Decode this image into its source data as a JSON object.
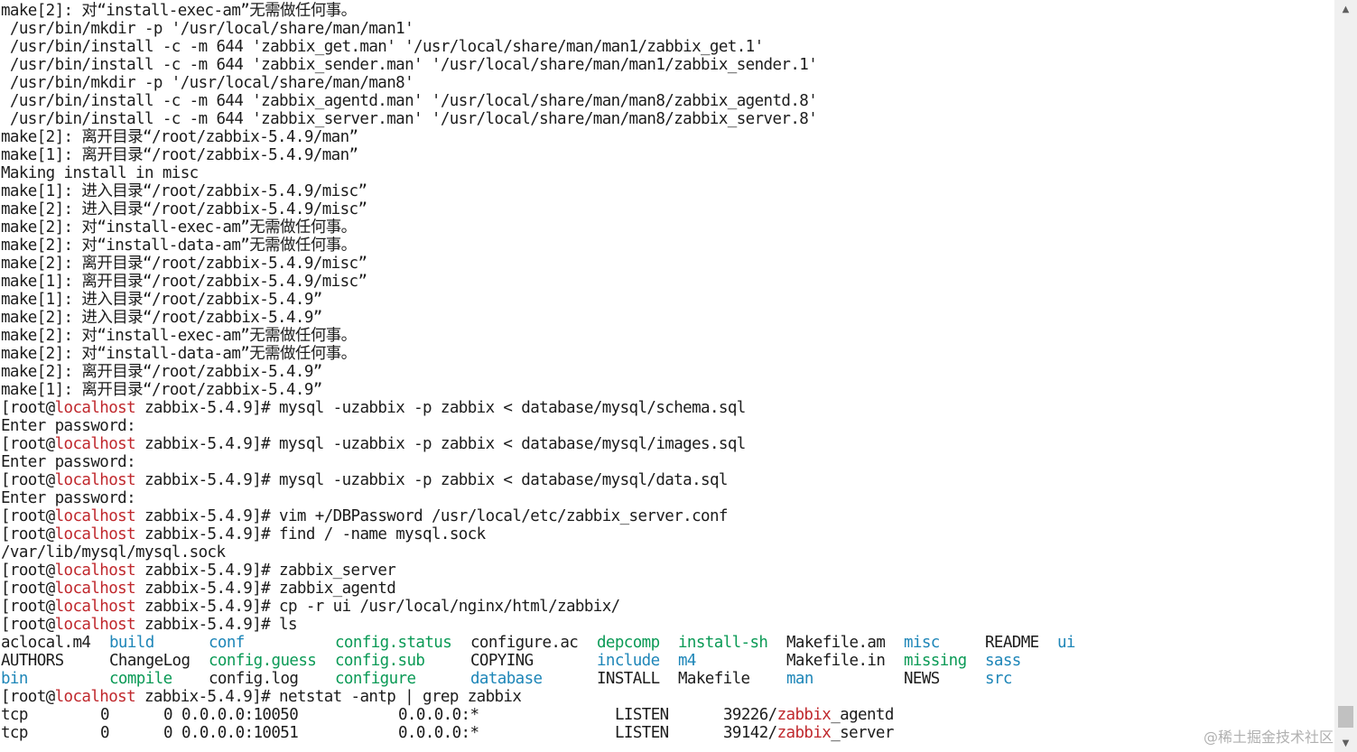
{
  "colors": {
    "background": "#ffffff",
    "text": "#1c1c1c",
    "hostname": "#c0282d",
    "directory": "#1e86b8",
    "executable": "#0b9a56"
  },
  "terminal": {
    "lines": [
      [
        {
          "t": "make[2]: 对“install-exec-am”无需做任何事。"
        }
      ],
      [
        {
          "t": " /usr/bin/mkdir -p '/usr/local/share/man/man1'"
        }
      ],
      [
        {
          "t": " /usr/bin/install -c -m 644 'zabbix_get.man' '/usr/local/share/man/man1/zabbix_get.1'"
        }
      ],
      [
        {
          "t": " /usr/bin/install -c -m 644 'zabbix_sender.man' '/usr/local/share/man/man1/zabbix_sender.1'"
        }
      ],
      [
        {
          "t": " /usr/bin/mkdir -p '/usr/local/share/man/man8'"
        }
      ],
      [
        {
          "t": " /usr/bin/install -c -m 644 'zabbix_agentd.man' '/usr/local/share/man/man8/zabbix_agentd.8'"
        }
      ],
      [
        {
          "t": " /usr/bin/install -c -m 644 'zabbix_server.man' '/usr/local/share/man/man8/zabbix_server.8'"
        }
      ],
      [
        {
          "t": "make[2]: 离开目录“/root/zabbix-5.4.9/man”"
        }
      ],
      [
        {
          "t": "make[1]: 离开目录“/root/zabbix-5.4.9/man”"
        }
      ],
      [
        {
          "t": "Making install in misc"
        }
      ],
      [
        {
          "t": "make[1]: 进入目录“/root/zabbix-5.4.9/misc”"
        }
      ],
      [
        {
          "t": "make[2]: 进入目录“/root/zabbix-5.4.9/misc”"
        }
      ],
      [
        {
          "t": "make[2]: 对“install-exec-am”无需做任何事。"
        }
      ],
      [
        {
          "t": "make[2]: 对“install-data-am”无需做任何事。"
        }
      ],
      [
        {
          "t": "make[2]: 离开目录“/root/zabbix-5.4.9/misc”"
        }
      ],
      [
        {
          "t": "make[1]: 离开目录“/root/zabbix-5.4.9/misc”"
        }
      ],
      [
        {
          "t": "make[1]: 进入目录“/root/zabbix-5.4.9”"
        }
      ],
      [
        {
          "t": "make[2]: 进入目录“/root/zabbix-5.4.9”"
        }
      ],
      [
        {
          "t": "make[2]: 对“install-exec-am”无需做任何事。"
        }
      ],
      [
        {
          "t": "make[2]: 对“install-data-am”无需做任何事。"
        }
      ],
      [
        {
          "t": "make[2]: 离开目录“/root/zabbix-5.4.9”"
        }
      ],
      [
        {
          "t": "make[1]: 离开目录“/root/zabbix-5.4.9”"
        }
      ],
      [
        {
          "t": "[root@"
        },
        {
          "t": "localhost",
          "c": "red"
        },
        {
          "t": " zabbix-5.4.9]# mysql -uzabbix -p zabbix < database/mysql/schema.sql"
        }
      ],
      [
        {
          "t": "Enter password:"
        }
      ],
      [
        {
          "t": "[root@"
        },
        {
          "t": "localhost",
          "c": "red"
        },
        {
          "t": " zabbix-5.4.9]# mysql -uzabbix -p zabbix < database/mysql/images.sql"
        }
      ],
      [
        {
          "t": "Enter password:"
        }
      ],
      [
        {
          "t": "[root@"
        },
        {
          "t": "localhost",
          "c": "red"
        },
        {
          "t": " zabbix-5.4.9]# mysql -uzabbix -p zabbix < database/mysql/data.sql"
        }
      ],
      [
        {
          "t": "Enter password:"
        }
      ],
      [
        {
          "t": "[root@"
        },
        {
          "t": "localhost",
          "c": "red"
        },
        {
          "t": " zabbix-5.4.9]# vim +/DBPassword /usr/local/etc/zabbix_server.conf"
        }
      ],
      [
        {
          "t": "[root@"
        },
        {
          "t": "localhost",
          "c": "red"
        },
        {
          "t": " zabbix-5.4.9]# find / -name mysql.sock"
        }
      ],
      [
        {
          "t": "/var/lib/mysql/mysql.sock"
        }
      ],
      [
        {
          "t": "[root@"
        },
        {
          "t": "localhost",
          "c": "red"
        },
        {
          "t": " zabbix-5.4.9]# zabbix_server"
        }
      ],
      [
        {
          "t": "[root@"
        },
        {
          "t": "localhost",
          "c": "red"
        },
        {
          "t": " zabbix-5.4.9]# zabbix_agentd"
        }
      ],
      [
        {
          "t": "[root@"
        },
        {
          "t": "localhost",
          "c": "red"
        },
        {
          "t": " zabbix-5.4.9]# cp -r ui /usr/local/nginx/html/zabbix/"
        }
      ],
      [
        {
          "t": "[root@"
        },
        {
          "t": "localhost",
          "c": "red"
        },
        {
          "t": " zabbix-5.4.9]# ls"
        }
      ]
    ],
    "ls_rows": [
      [
        {
          "t": "aclocal.m4"
        },
        {
          "t": "build",
          "c": "blue"
        },
        {
          "t": "conf",
          "c": "blue"
        },
        {
          "t": "config.status",
          "c": "green"
        },
        {
          "t": "configure.ac"
        },
        {
          "t": "depcomp",
          "c": "green"
        },
        {
          "t": "install-sh",
          "c": "green"
        },
        {
          "t": "Makefile.am"
        },
        {
          "t": "misc",
          "c": "blue"
        },
        {
          "t": "README"
        },
        {
          "t": "ui",
          "c": "blue"
        }
      ],
      [
        {
          "t": "AUTHORS"
        },
        {
          "t": "ChangeLog"
        },
        {
          "t": "config.guess",
          "c": "green"
        },
        {
          "t": "config.sub",
          "c": "green"
        },
        {
          "t": "COPYING"
        },
        {
          "t": "include",
          "c": "blue"
        },
        {
          "t": "m4",
          "c": "blue"
        },
        {
          "t": "Makefile.in"
        },
        {
          "t": "missing",
          "c": "green"
        },
        {
          "t": "sass",
          "c": "blue"
        },
        {
          "t": ""
        }
      ],
      [
        {
          "t": "bin",
          "c": "blue"
        },
        {
          "t": "compile",
          "c": "green"
        },
        {
          "t": "config.log"
        },
        {
          "t": "configure",
          "c": "green"
        },
        {
          "t": "database",
          "c": "blue"
        },
        {
          "t": "INSTALL"
        },
        {
          "t": "Makefile"
        },
        {
          "t": "man",
          "c": "blue"
        },
        {
          "t": "NEWS"
        },
        {
          "t": "src",
          "c": "blue"
        },
        {
          "t": ""
        }
      ]
    ],
    "netstat_prompt": [
      {
        "t": "[root@"
      },
      {
        "t": "localhost",
        "c": "red"
      },
      {
        "t": " zabbix-5.4.9]# netstat -antp | grep zabbix"
      }
    ],
    "netstat_rows": [
      {
        "proto": "tcp",
        "recvq": "0",
        "sendq": "0",
        "local": "0.0.0.0:10050",
        "foreign": "0.0.0.0:*",
        "state": "LISTEN",
        "pid": "39226/",
        "prog_match": "zabbix",
        "prog_rest": "_agentd"
      },
      {
        "proto": "tcp",
        "recvq": "0",
        "sendq": "0",
        "local": "0.0.0.0:10051",
        "foreign": "0.0.0.0:*",
        "state": "LISTEN",
        "pid": "39142/",
        "prog_match": "zabbix",
        "prog_rest": "_server"
      }
    ]
  },
  "watermark": "@稀土掘金技术社区",
  "scrollbar": {
    "up_icon": "scroll-up-arrow-icon",
    "down_icon": "scroll-down-arrow-icon"
  }
}
